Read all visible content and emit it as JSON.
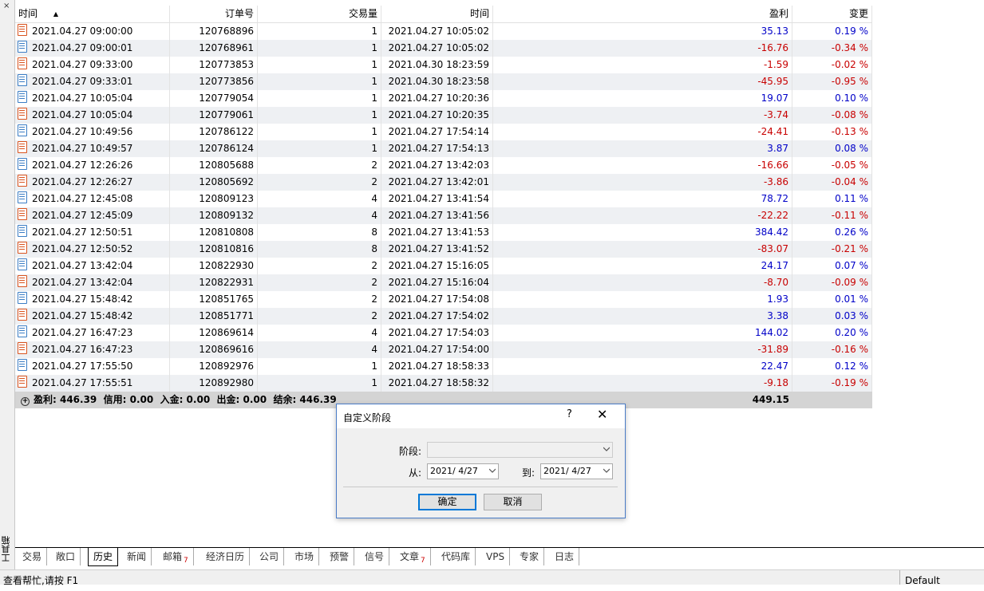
{
  "side": {
    "label": "工具箱",
    "close_icon": "×"
  },
  "columns": {
    "time": "时间",
    "order": "订单号",
    "volume": "交易量",
    "time2": "时间",
    "profit": "盈利",
    "change": "变更"
  },
  "rows": [
    {
      "type": "sell",
      "time": "2021.04.27 09:00:00",
      "order": "120768896",
      "volume": "1",
      "close_time": "2021.04.27 10:05:02",
      "profit": "35.13",
      "change": "0.19 %"
    },
    {
      "type": "buy",
      "time": "2021.04.27 09:00:01",
      "order": "120768961",
      "volume": "1",
      "close_time": "2021.04.27 10:05:02",
      "profit": "-16.76",
      "change": "-0.34 %"
    },
    {
      "type": "sell",
      "time": "2021.04.27 09:33:00",
      "order": "120773853",
      "volume": "1",
      "close_time": "2021.04.30 18:23:59",
      "profit": "-1.59",
      "change": "-0.02 %"
    },
    {
      "type": "buy",
      "time": "2021.04.27 09:33:01",
      "order": "120773856",
      "volume": "1",
      "close_time": "2021.04.30 18:23:58",
      "profit": "-45.95",
      "change": "-0.95 %"
    },
    {
      "type": "buy",
      "time": "2021.04.27 10:05:04",
      "order": "120779054",
      "volume": "1",
      "close_time": "2021.04.27 10:20:36",
      "profit": "19.07",
      "change": "0.10 %"
    },
    {
      "type": "sell",
      "time": "2021.04.27 10:05:04",
      "order": "120779061",
      "volume": "1",
      "close_time": "2021.04.27 10:20:35",
      "profit": "-3.74",
      "change": "-0.08 %"
    },
    {
      "type": "buy",
      "time": "2021.04.27 10:49:56",
      "order": "120786122",
      "volume": "1",
      "close_time": "2021.04.27 17:54:14",
      "profit": "-24.41",
      "change": "-0.13 %"
    },
    {
      "type": "sell",
      "time": "2021.04.27 10:49:57",
      "order": "120786124",
      "volume": "1",
      "close_time": "2021.04.27 17:54:13",
      "profit": "3.87",
      "change": "0.08 %"
    },
    {
      "type": "buy",
      "time": "2021.04.27 12:26:26",
      "order": "120805688",
      "volume": "2",
      "close_time": "2021.04.27 13:42:03",
      "profit": "-16.66",
      "change": "-0.05 %"
    },
    {
      "type": "sell",
      "time": "2021.04.27 12:26:27",
      "order": "120805692",
      "volume": "2",
      "close_time": "2021.04.27 13:42:01",
      "profit": "-3.86",
      "change": "-0.04 %"
    },
    {
      "type": "buy",
      "time": "2021.04.27 12:45:08",
      "order": "120809123",
      "volume": "4",
      "close_time": "2021.04.27 13:41:54",
      "profit": "78.72",
      "change": "0.11 %"
    },
    {
      "type": "sell",
      "time": "2021.04.27 12:45:09",
      "order": "120809132",
      "volume": "4",
      "close_time": "2021.04.27 13:41:56",
      "profit": "-22.22",
      "change": "-0.11 %"
    },
    {
      "type": "buy",
      "time": "2021.04.27 12:50:51",
      "order": "120810808",
      "volume": "8",
      "close_time": "2021.04.27 13:41:53",
      "profit": "384.42",
      "change": "0.26 %"
    },
    {
      "type": "sell",
      "time": "2021.04.27 12:50:52",
      "order": "120810816",
      "volume": "8",
      "close_time": "2021.04.27 13:41:52",
      "profit": "-83.07",
      "change": "-0.21 %"
    },
    {
      "type": "buy",
      "time": "2021.04.27 13:42:04",
      "order": "120822930",
      "volume": "2",
      "close_time": "2021.04.27 15:16:05",
      "profit": "24.17",
      "change": "0.07 %"
    },
    {
      "type": "sell",
      "time": "2021.04.27 13:42:04",
      "order": "120822931",
      "volume": "2",
      "close_time": "2021.04.27 15:16:04",
      "profit": "-8.70",
      "change": "-0.09 %"
    },
    {
      "type": "buy",
      "time": "2021.04.27 15:48:42",
      "order": "120851765",
      "volume": "2",
      "close_time": "2021.04.27 17:54:08",
      "profit": "1.93",
      "change": "0.01 %"
    },
    {
      "type": "sell",
      "time": "2021.04.27 15:48:42",
      "order": "120851771",
      "volume": "2",
      "close_time": "2021.04.27 17:54:02",
      "profit": "3.38",
      "change": "0.03 %"
    },
    {
      "type": "buy",
      "time": "2021.04.27 16:47:23",
      "order": "120869614",
      "volume": "4",
      "close_time": "2021.04.27 17:54:03",
      "profit": "144.02",
      "change": "0.20 %"
    },
    {
      "type": "sell",
      "time": "2021.04.27 16:47:23",
      "order": "120869616",
      "volume": "4",
      "close_time": "2021.04.27 17:54:00",
      "profit": "-31.89",
      "change": "-0.16 %"
    },
    {
      "type": "buy",
      "time": "2021.04.27 17:55:50",
      "order": "120892976",
      "volume": "1",
      "close_time": "2021.04.27 18:58:33",
      "profit": "22.47",
      "change": "0.12 %"
    },
    {
      "type": "sell",
      "time": "2021.04.27 17:55:51",
      "order": "120892980",
      "volume": "1",
      "close_time": "2021.04.27 18:58:32",
      "profit": "-9.18",
      "change": "-0.19 %"
    }
  ],
  "summary": {
    "text": "盈利: 446.39  信用: 0.00  入金: 0.00  出金: 0.00  结余: 446.39",
    "total": "449.15"
  },
  "tabs": [
    {
      "label": "交易"
    },
    {
      "label": "敞口"
    },
    {
      "label": "历史",
      "active": true
    },
    {
      "label": "新闻"
    },
    {
      "label": "邮箱",
      "badge": "7"
    },
    {
      "label": "经济日历"
    },
    {
      "label": "公司"
    },
    {
      "label": "市场"
    },
    {
      "label": "预警"
    },
    {
      "label": "信号"
    },
    {
      "label": "文章",
      "badge": "7"
    },
    {
      "label": "代码库"
    },
    {
      "label": "VPS"
    },
    {
      "label": "专家"
    },
    {
      "label": "日志"
    }
  ],
  "status": {
    "help": "查看帮忙,请按 F1",
    "profile": "Default"
  },
  "dialog": {
    "title": "自定义阶段",
    "help": "?",
    "close": "✕",
    "period_label": "阶段:",
    "period_value": "",
    "from_label": "从:",
    "from_value": "2021/ 4/27",
    "to_label": "到:",
    "to_value": "2021/ 4/27",
    "ok": "确定",
    "cancel": "取消"
  },
  "colors": {
    "positive": "#0000c8",
    "negative": "#c80000",
    "buy_icon": "#3b7dc4",
    "sell_icon": "#d9531e",
    "accent": "#0078d7"
  }
}
